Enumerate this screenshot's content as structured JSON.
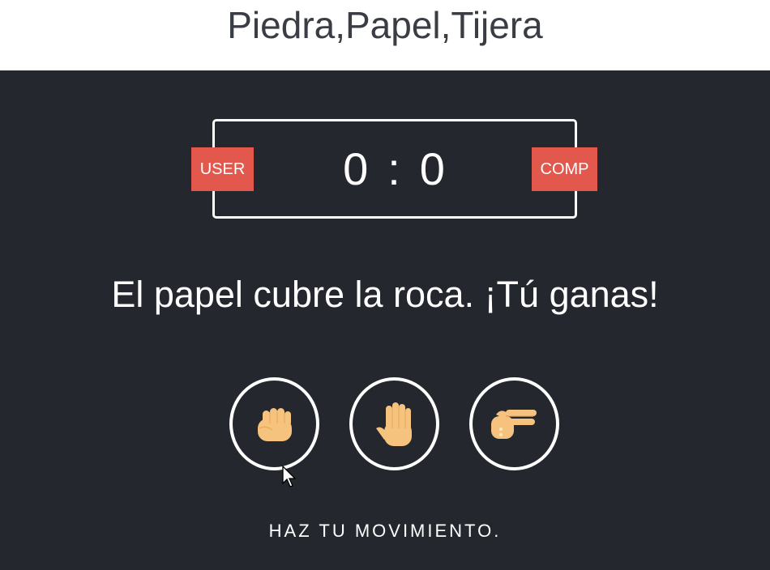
{
  "header": {
    "title": "Piedra,Papel,Tijera"
  },
  "scoreboard": {
    "user_label": "USER",
    "comp_label": "COMP",
    "user_score": "0",
    "separator": ":",
    "comp_score": "0"
  },
  "result": {
    "message": "El papel cubre la roca. ¡Tú ganas!"
  },
  "choices": [
    {
      "id": "rock",
      "icon": "fist-hand-icon"
    },
    {
      "id": "paper",
      "icon": "open-hand-icon"
    },
    {
      "id": "scissors",
      "icon": "scissors-hand-icon"
    }
  ],
  "instruction": {
    "text": "HAZ TU MOVIMIENTO."
  },
  "colors": {
    "background": "#24272E",
    "header_bg": "#FFFFFF",
    "header_text": "#3A3D44",
    "badge": "#E2584D",
    "hand_skin": "#F6C37E",
    "hand_shadow": "#E8A95C"
  }
}
